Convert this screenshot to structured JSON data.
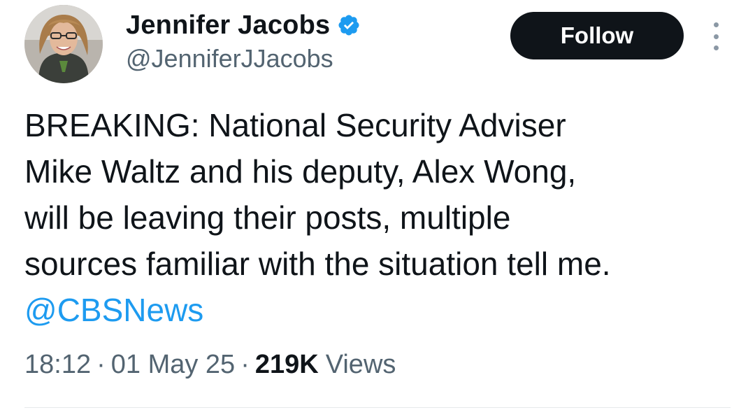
{
  "author": {
    "display_name": "Jennifer Jacobs",
    "handle": "@JenniferJJacobs",
    "verified": true,
    "verified_color": "#1d9bf0"
  },
  "actions": {
    "follow_label": "Follow",
    "more_icon": "more-vertical-icon"
  },
  "tweet": {
    "lines": [
      "BREAKING: National Security Adviser",
      "Mike Waltz and his deputy, Alex Wong,",
      "will be leaving their posts, multiple",
      "sources familiar with the situation tell me."
    ],
    "mention": "@CBSNews",
    "mention_color": "#1d9bf0"
  },
  "meta": {
    "time": "18:12",
    "separator": "·",
    "date": "01 May 25",
    "views_count": "219K",
    "views_label": "Views"
  },
  "colors": {
    "text": "#0f1419",
    "secondary": "#536471",
    "follow_bg": "#0f1419",
    "follow_text": "#ffffff"
  }
}
